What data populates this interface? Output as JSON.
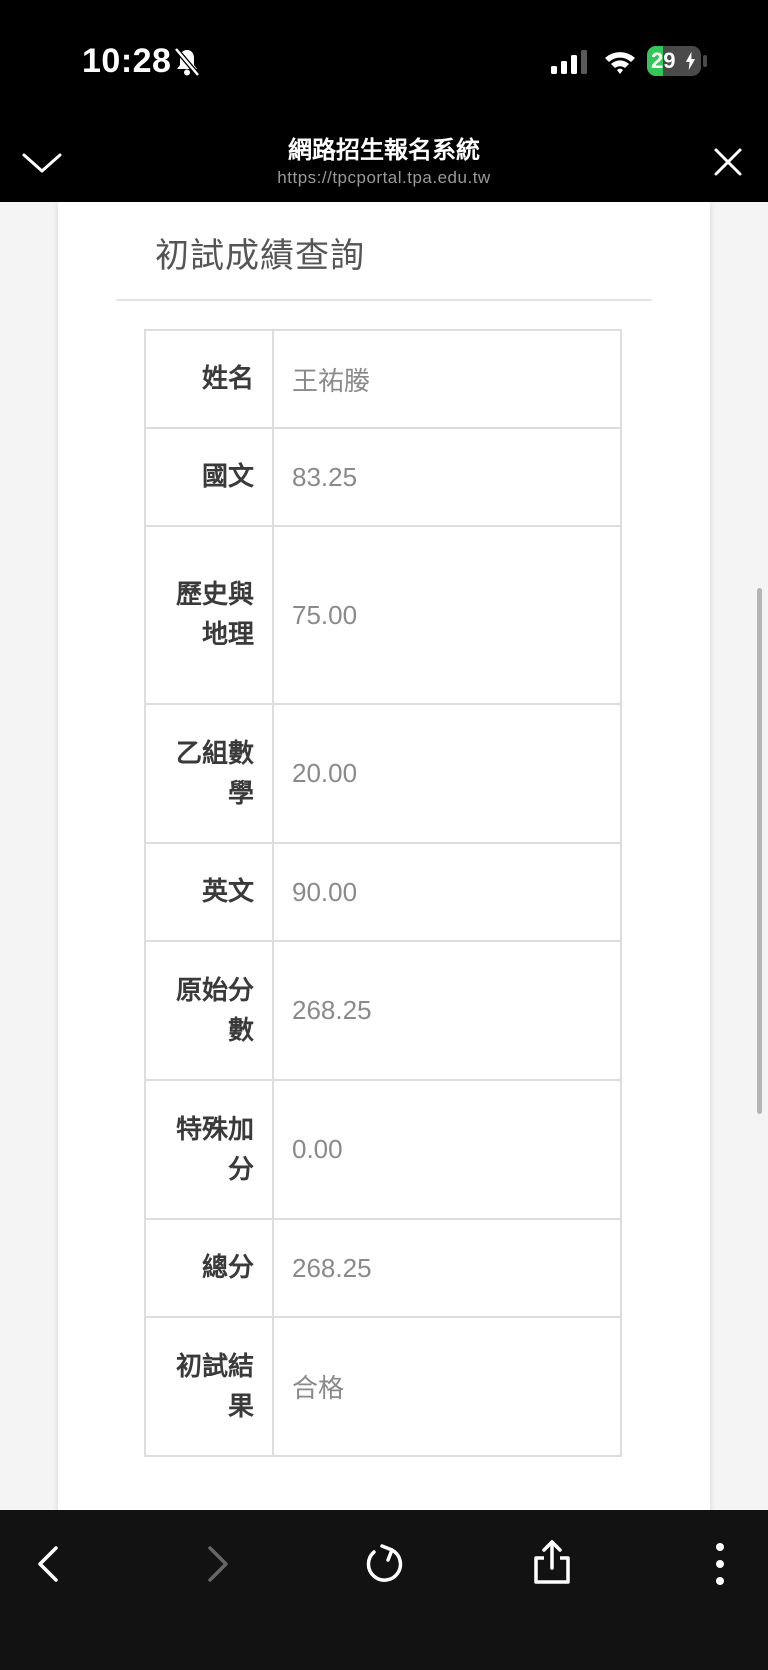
{
  "status_bar": {
    "time": "10:28",
    "battery_level": "29",
    "battery_fill_fraction": 0.29,
    "charging": true,
    "silent_mode": true
  },
  "browser": {
    "title": "網路招生報名系統",
    "url": "https://tpcportal.tpa.edu.tw"
  },
  "card": {
    "title": "初試成績查詢"
  },
  "score_rows": [
    {
      "label": "姓名",
      "value": "王祐媵"
    },
    {
      "label": "國文",
      "value": "83.25"
    },
    {
      "label": "歷史與地理",
      "value": "75.00"
    },
    {
      "label": "乙組數學",
      "value": "20.00"
    },
    {
      "label": "英文",
      "value": "90.00"
    },
    {
      "label": "原始分數",
      "value": "268.25"
    },
    {
      "label": "特殊加分",
      "value": "0.00"
    },
    {
      "label": "總分",
      "value": "268.25"
    },
    {
      "label": "初試結果",
      "value": "合格"
    }
  ],
  "colors": {
    "battery_green": "#33c759",
    "browser_chrome": "#000000",
    "toolbar": "#121212"
  }
}
